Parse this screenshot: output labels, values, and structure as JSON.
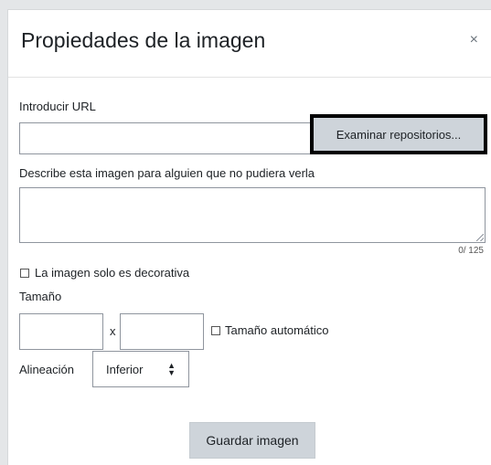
{
  "dialog": {
    "title": "Propiedades de la imagen",
    "close_symbol": "×"
  },
  "url": {
    "label": "Introducir URL",
    "value": "",
    "browse_label": "Examinar repositorios..."
  },
  "description": {
    "label": "Describe esta imagen para alguien que no pudiera verla",
    "value": "",
    "counter": "0/ 125"
  },
  "decorative": {
    "label": "La imagen solo es decorativa",
    "checked": false
  },
  "size": {
    "label": "Tamaño",
    "width": "",
    "height": "",
    "separator": "x",
    "auto_label": "Tamaño automático",
    "auto_checked": false
  },
  "alignment": {
    "label": "Alineación",
    "selected": "Inferior",
    "arrows": "▲▼"
  },
  "save_label": "Guardar imagen",
  "icons": {
    "close": "close-icon",
    "select_arrows": "chevron-updown-icon",
    "resize": "resize-grip-icon"
  },
  "colors": {
    "button_bg": "#ced4da",
    "page_bg": "#e4e6e8",
    "highlight_border": "#000000"
  }
}
